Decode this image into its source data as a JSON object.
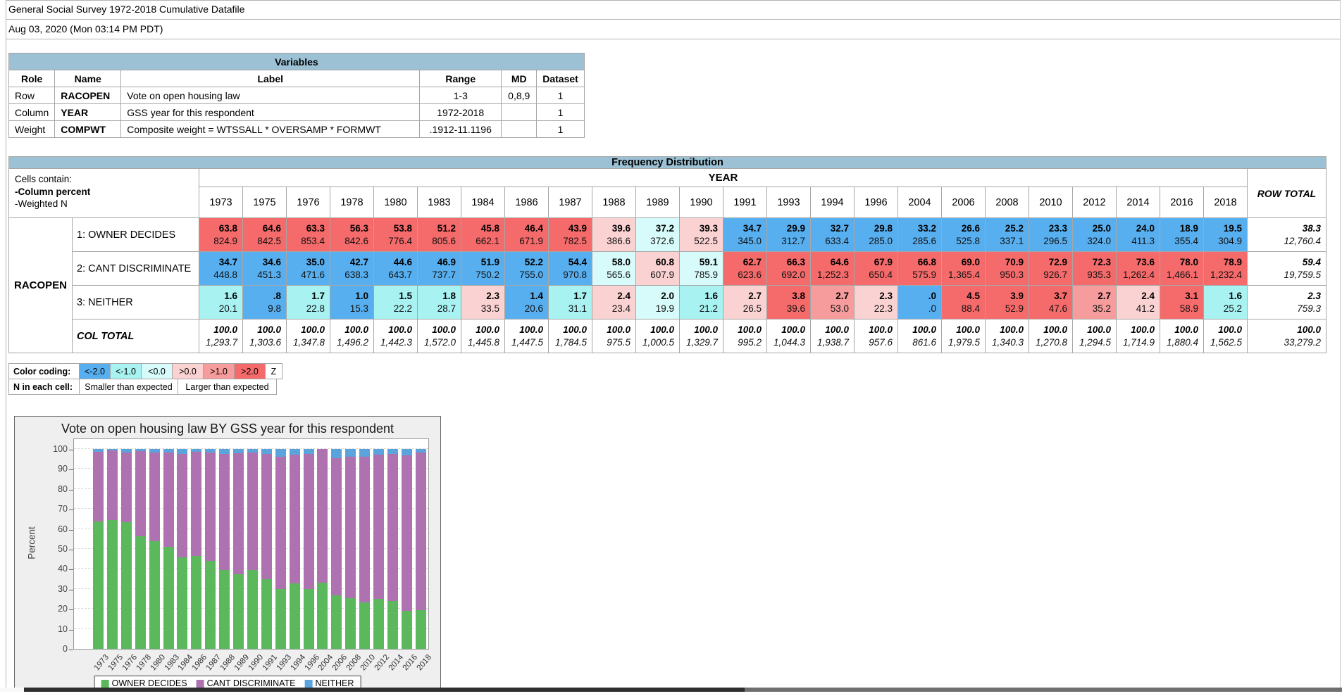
{
  "page": {
    "title": "General Social Survey 1972-2018 Cumulative Datafile",
    "date": "Aug 03, 2020 (Mon 03:14 PM PDT)"
  },
  "colors": {
    "header_bar": "#9CC1D4",
    "z_categories": {
      "b2": "#58AFF0",
      "c1": "#A8F2F2",
      "c0": "#D7FAFA",
      "p0": "#FBD2D2",
      "p1": "#F79C9C",
      "r2": "#F56A6A"
    },
    "chart_green": "#5CB85C",
    "chart_purple": "#AF72B0",
    "chart_blue": "#5BA3DC"
  },
  "variables_table": {
    "title": "Variables",
    "columns": [
      "Role",
      "Name",
      "Label",
      "Range",
      "MD",
      "Dataset"
    ],
    "rows": [
      {
        "role": "Row",
        "name": "RACOPEN",
        "label": "Vote on open housing law",
        "range": "1-3",
        "md": "0,8,9",
        "dataset": "1"
      },
      {
        "role": "Column",
        "name": "YEAR",
        "label": "GSS year for this respondent",
        "range": "1972-2018",
        "md": "",
        "dataset": "1"
      },
      {
        "role": "Weight",
        "name": "COMPWT",
        "label": "Composite weight = WTSSALL * OVERSAMP * FORMWT",
        "range": ".1912-11.1196",
        "md": "",
        "dataset": "1"
      }
    ]
  },
  "frequency_table": {
    "title": "Frequency Distribution",
    "cells_contain_lines": [
      "Cells contain:",
      "-Column percent",
      "-Weighted N"
    ],
    "col_var": "YEAR",
    "row_var": "RACOPEN",
    "row_total_label": "ROW TOTAL",
    "years": [
      "1973",
      "1975",
      "1976",
      "1978",
      "1980",
      "1983",
      "1984",
      "1986",
      "1987",
      "1988",
      "1989",
      "1990",
      "1991",
      "1993",
      "1994",
      "1996",
      "2004",
      "2006",
      "2008",
      "2010",
      "2012",
      "2014",
      "2016",
      "2018"
    ],
    "rows": [
      {
        "label": "1: OWNER DECIDES",
        "pct": [
          "63.8",
          "64.6",
          "63.3",
          "56.3",
          "53.8",
          "51.2",
          "45.8",
          "46.4",
          "43.9",
          "39.6",
          "37.2",
          "39.3",
          "34.7",
          "29.9",
          "32.7",
          "29.8",
          "33.2",
          "26.6",
          "25.2",
          "23.3",
          "25.0",
          "24.0",
          "18.9",
          "19.5"
        ],
        "n": [
          "824.9",
          "842.5",
          "853.4",
          "842.6",
          "776.4",
          "805.6",
          "662.1",
          "671.9",
          "782.5",
          "386.6",
          "372.6",
          "522.5",
          "345.0",
          "312.7",
          "633.4",
          "285.0",
          "285.6",
          "525.8",
          "337.1",
          "296.5",
          "324.0",
          "411.3",
          "355.4",
          "304.9"
        ],
        "z": [
          "r2",
          "r2",
          "r2",
          "r2",
          "r2",
          "r2",
          "r2",
          "r2",
          "r2",
          "p0",
          "c0",
          "p0",
          "b2",
          "b2",
          "b2",
          "b2",
          "b2",
          "b2",
          "b2",
          "b2",
          "b2",
          "b2",
          "b2",
          "b2"
        ],
        "total_pct": "38.3",
        "total_n": "12,760.4"
      },
      {
        "label": "2: CANT DISCRIMINATE",
        "pct": [
          "34.7",
          "34.6",
          "35.0",
          "42.7",
          "44.6",
          "46.9",
          "51.9",
          "52.2",
          "54.4",
          "58.0",
          "60.8",
          "59.1",
          "62.7",
          "66.3",
          "64.6",
          "67.9",
          "66.8",
          "69.0",
          "70.9",
          "72.9",
          "72.3",
          "73.6",
          "78.0",
          "78.9"
        ],
        "n": [
          "448.8",
          "451.3",
          "471.6",
          "638.3",
          "643.7",
          "737.7",
          "750.2",
          "755.0",
          "970.8",
          "565.6",
          "607.9",
          "785.9",
          "623.6",
          "692.0",
          "1,252.3",
          "650.4",
          "575.9",
          "1,365.4",
          "950.3",
          "926.7",
          "935.3",
          "1,262.4",
          "1,466.1",
          "1,232.4"
        ],
        "z": [
          "b2",
          "b2",
          "b2",
          "b2",
          "b2",
          "b2",
          "b2",
          "b2",
          "b2",
          "c0",
          "p0",
          "c0",
          "r2",
          "r2",
          "r2",
          "r2",
          "r2",
          "r2",
          "r2",
          "r2",
          "r2",
          "r2",
          "r2",
          "r2"
        ],
        "total_pct": "59.4",
        "total_n": "19,759.5"
      },
      {
        "label": "3: NEITHER",
        "pct": [
          "1.6",
          ".8",
          "1.7",
          "1.0",
          "1.5",
          "1.8",
          "2.3",
          "1.4",
          "1.7",
          "2.4",
          "2.0",
          "1.6",
          "2.7",
          "3.8",
          "2.7",
          "2.3",
          ".0",
          "4.5",
          "3.9",
          "3.7",
          "2.7",
          "2.4",
          "3.1",
          "1.6"
        ],
        "n": [
          "20.1",
          "9.8",
          "22.8",
          "15.3",
          "22.2",
          "28.7",
          "33.5",
          "20.6",
          "31.1",
          "23.4",
          "19.9",
          "21.2",
          "26.5",
          "39.6",
          "53.0",
          "22.3",
          ".0",
          "88.4",
          "52.9",
          "47.6",
          "35.2",
          "41.2",
          "58.9",
          "25.2"
        ],
        "z": [
          "c1",
          "b2",
          "c1",
          "b2",
          "c1",
          "c1",
          "p0",
          "b2",
          "c1",
          "p0",
          "c0",
          "c1",
          "p0",
          "r2",
          "p1",
          "p0",
          "b2",
          "r2",
          "r2",
          "r2",
          "p1",
          "p0",
          "r2",
          "c1"
        ],
        "total_pct": "2.3",
        "total_n": "759.3"
      }
    ],
    "col_total": {
      "label": "COL TOTAL",
      "pct_label": "100.0",
      "n": [
        "1,293.7",
        "1,303.6",
        "1,347.8",
        "1,496.2",
        "1,442.3",
        "1,572.0",
        "1,445.8",
        "1,447.5",
        "1,784.5",
        "975.5",
        "1,000.5",
        "1,329.7",
        "995.2",
        "1,044.3",
        "1,938.7",
        "957.6",
        "861.6",
        "1,979.5",
        "1,340.3",
        "1,270.8",
        "1,294.5",
        "1,714.9",
        "1,880.4",
        "1,562.5"
      ],
      "total_pct": "100.0",
      "total_n": "33,279.2"
    }
  },
  "color_coding": {
    "row1_label": "Color coding:",
    "swatches": [
      {
        "label": "<-2.0",
        "z": "b2"
      },
      {
        "label": "<-1.0",
        "z": "c1"
      },
      {
        "label": "<0.0",
        "z": "c0"
      },
      {
        "label": ">0.0",
        "z": "p0"
      },
      {
        "label": ">1.0",
        "z": "p1"
      },
      {
        "label": ">2.0",
        "z": "r2"
      }
    ],
    "z_label": "Z",
    "row2_label": "N in each cell:",
    "smaller_label": "Smaller than expected",
    "larger_label": "Larger than expected"
  },
  "chart": {
    "title": "Vote on open housing law BY GSS year for this respondent",
    "ylabel": "Percent",
    "yticks": [
      0,
      10,
      20,
      30,
      40,
      50,
      60,
      70,
      80,
      90,
      100
    ],
    "legend": [
      {
        "label": "OWNER DECIDES",
        "color": "#5CB85C"
      },
      {
        "label": "CANT DISCRIMINATE",
        "color": "#AF72B0"
      },
      {
        "label": "NEITHER",
        "color": "#5BA3DC"
      }
    ]
  },
  "chart_data": {
    "type": "bar",
    "stacked": true,
    "title": "Vote on open housing law BY GSS year for this respondent",
    "xlabel": "",
    "ylabel": "Percent",
    "ylim": [
      0,
      100
    ],
    "grid": "dashed-horizontal",
    "legend_position": "bottom",
    "categories": [
      "1973",
      "1975",
      "1976",
      "1978",
      "1980",
      "1983",
      "1984",
      "1986",
      "1987",
      "1988",
      "1989",
      "1990",
      "1991",
      "1993",
      "1994",
      "1996",
      "2004",
      "2006",
      "2008",
      "2010",
      "2012",
      "2014",
      "2016",
      "2018"
    ],
    "series": [
      {
        "name": "OWNER DECIDES",
        "color": "#5CB85C",
        "values": [
          63.8,
          64.6,
          63.3,
          56.3,
          53.8,
          51.2,
          45.8,
          46.4,
          43.9,
          39.6,
          37.2,
          39.3,
          34.7,
          29.9,
          32.7,
          29.8,
          33.2,
          26.6,
          25.2,
          23.3,
          25.0,
          24.0,
          18.9,
          19.5
        ]
      },
      {
        "name": "CANT DISCRIMINATE",
        "color": "#AF72B0",
        "values": [
          34.7,
          34.6,
          35.0,
          42.7,
          44.6,
          46.9,
          51.9,
          52.2,
          54.4,
          58.0,
          60.8,
          59.1,
          62.7,
          66.3,
          64.6,
          67.9,
          66.8,
          69.0,
          70.9,
          72.9,
          72.3,
          73.6,
          78.0,
          78.9
        ]
      },
      {
        "name": "NEITHER",
        "color": "#5BA3DC",
        "values": [
          1.6,
          0.8,
          1.7,
          1.0,
          1.5,
          1.8,
          2.3,
          1.4,
          1.7,
          2.4,
          2.0,
          1.6,
          2.7,
          3.8,
          2.7,
          2.3,
          0.0,
          4.5,
          3.9,
          3.7,
          2.7,
          2.4,
          3.1,
          1.6
        ]
      }
    ]
  }
}
